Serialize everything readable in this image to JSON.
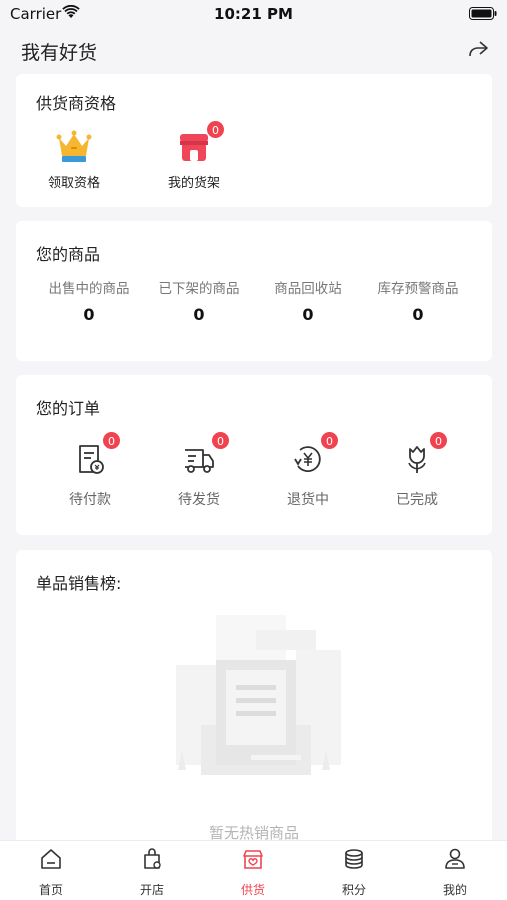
{
  "status_bar": {
    "carrier": "Carrier",
    "time": "10:21 PM"
  },
  "header": {
    "title": "我有好货"
  },
  "supplier": {
    "title": "供货商资格",
    "items": [
      {
        "label": "领取资格",
        "icon": "crown-icon"
      },
      {
        "label": "我的货架",
        "icon": "shop-icon",
        "badge": "0"
      }
    ]
  },
  "products": {
    "title": "您的商品",
    "stats": [
      {
        "label": "出售中的商品",
        "value": "0"
      },
      {
        "label": "已下架的商品",
        "value": "0"
      },
      {
        "label": "商品回收站",
        "value": "0"
      },
      {
        "label": "库存预警商品",
        "value": "0"
      }
    ]
  },
  "orders": {
    "title": "您的订单",
    "items": [
      {
        "label": "待付款",
        "icon": "bill-icon",
        "badge": "0"
      },
      {
        "label": "待发货",
        "icon": "truck-icon",
        "badge": "0"
      },
      {
        "label": "退货中",
        "icon": "refund-icon",
        "badge": "0"
      },
      {
        "label": "已完成",
        "icon": "flower-icon",
        "badge": "0"
      }
    ]
  },
  "ranking": {
    "title": "单品销售榜:",
    "empty_text": "暂无热销商品"
  },
  "tabbar": {
    "items": [
      {
        "label": "首页",
        "icon": "home-icon"
      },
      {
        "label": "开店",
        "icon": "store-bag-icon"
      },
      {
        "label": "供货",
        "icon": "supply-icon",
        "active": true
      },
      {
        "label": "积分",
        "icon": "coins-icon"
      },
      {
        "label": "我的",
        "icon": "user-icon"
      }
    ]
  },
  "colors": {
    "accent": "#ef4450",
    "background": "#f5f5f7",
    "crown": "#f5b731",
    "shop": "#f0465a"
  }
}
